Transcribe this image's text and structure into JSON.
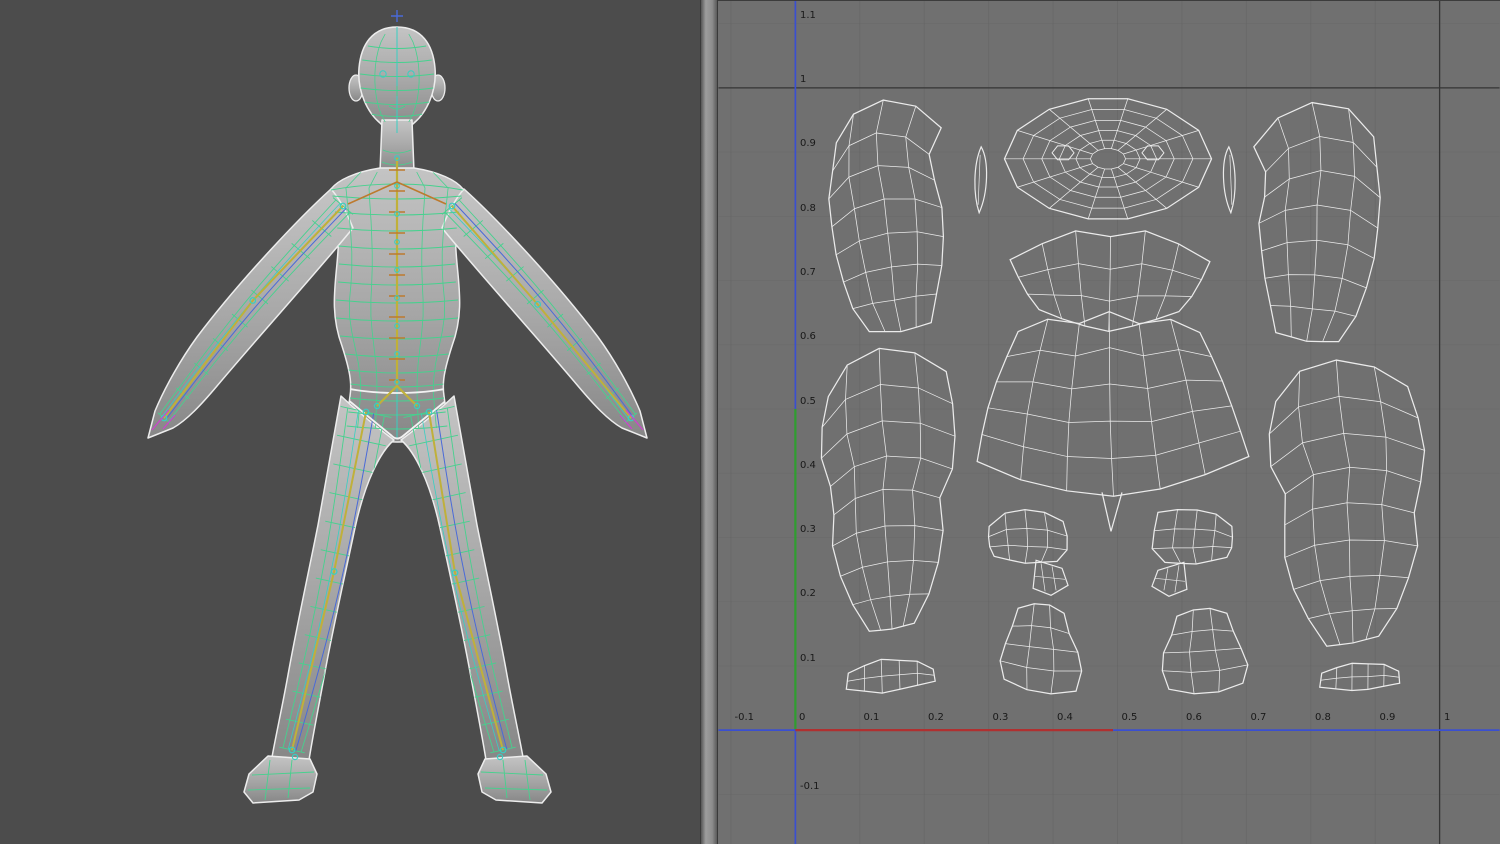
{
  "uv_editor": {
    "x_axis_ticks": [
      {
        "label": "-0.1",
        "value": -0.1
      },
      {
        "label": "0",
        "value": 0
      },
      {
        "label": "0.1",
        "value": 0.1
      },
      {
        "label": "0.2",
        "value": 0.2
      },
      {
        "label": "0.3",
        "value": 0.3
      },
      {
        "label": "0.4",
        "value": 0.4
      },
      {
        "label": "0.5",
        "value": 0.5
      },
      {
        "label": "0.6",
        "value": 0.6
      },
      {
        "label": "0.7",
        "value": 0.7
      },
      {
        "label": "0.8",
        "value": 0.8
      },
      {
        "label": "0.9",
        "value": 0.9
      },
      {
        "label": "1",
        "value": 1
      }
    ],
    "y_axis_ticks": [
      {
        "label": "1.1",
        "value": 1.1
      },
      {
        "label": "1",
        "value": 1
      },
      {
        "label": "0.9",
        "value": 0.9
      },
      {
        "label": "0.8",
        "value": 0.8
      },
      {
        "label": "0.7",
        "value": 0.7
      },
      {
        "label": "0.6",
        "value": 0.6
      },
      {
        "label": "0.5",
        "value": 0.5
      },
      {
        "label": "0.4",
        "value": 0.4
      },
      {
        "label": "0.3",
        "value": 0.3
      },
      {
        "label": "0.2",
        "value": 0.2
      },
      {
        "label": "0.1",
        "value": 0.1
      },
      {
        "label": "-0.1",
        "value": -0.1
      }
    ],
    "colors": {
      "background": "#707070",
      "grid_line": "#5e5e5e",
      "unit_line": "#353535",
      "axis_blue": "#3a4fd0",
      "axis_red": "#b03030",
      "axis_green": "#2f9e2f",
      "island_stroke": "#ebebeb",
      "label": "#191919"
    }
  },
  "viewport": {
    "colors": {
      "background": "#4c4c4c",
      "outline": "#ededed",
      "wireframe_green": "#46d18e",
      "wireframe_teal": "#38cfc2",
      "bone_yellow": "#c0b03a",
      "skeleton_orange": "#bd7a2e",
      "accent_blue": "#4a6ad8",
      "accent_magenta": "#cc44cc",
      "body_light": "#c4c4c4",
      "body_mid": "#a8a8a8",
      "body_dark": "#878787"
    }
  }
}
